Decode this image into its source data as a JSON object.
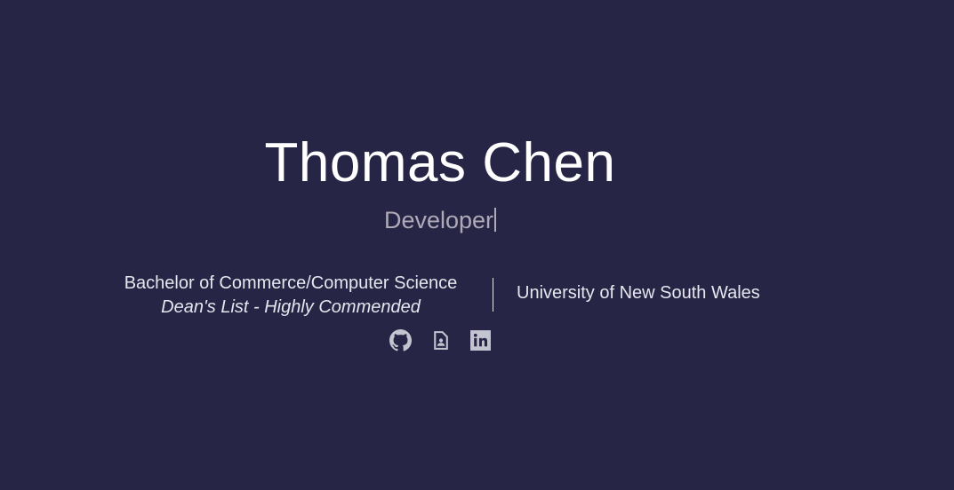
{
  "hero": {
    "name": "Thomas Chen",
    "role": "Developer"
  },
  "education": {
    "degree": "Bachelor of Commerce/Computer Science",
    "honours": "Dean's List - Highly Commended",
    "university": "University of New South Wales"
  },
  "social": [
    {
      "icon": "github-icon"
    },
    {
      "icon": "resume-icon"
    },
    {
      "icon": "linkedin-icon"
    }
  ],
  "colors": {
    "background": "#262546",
    "icon": "#c4c3d0"
  }
}
